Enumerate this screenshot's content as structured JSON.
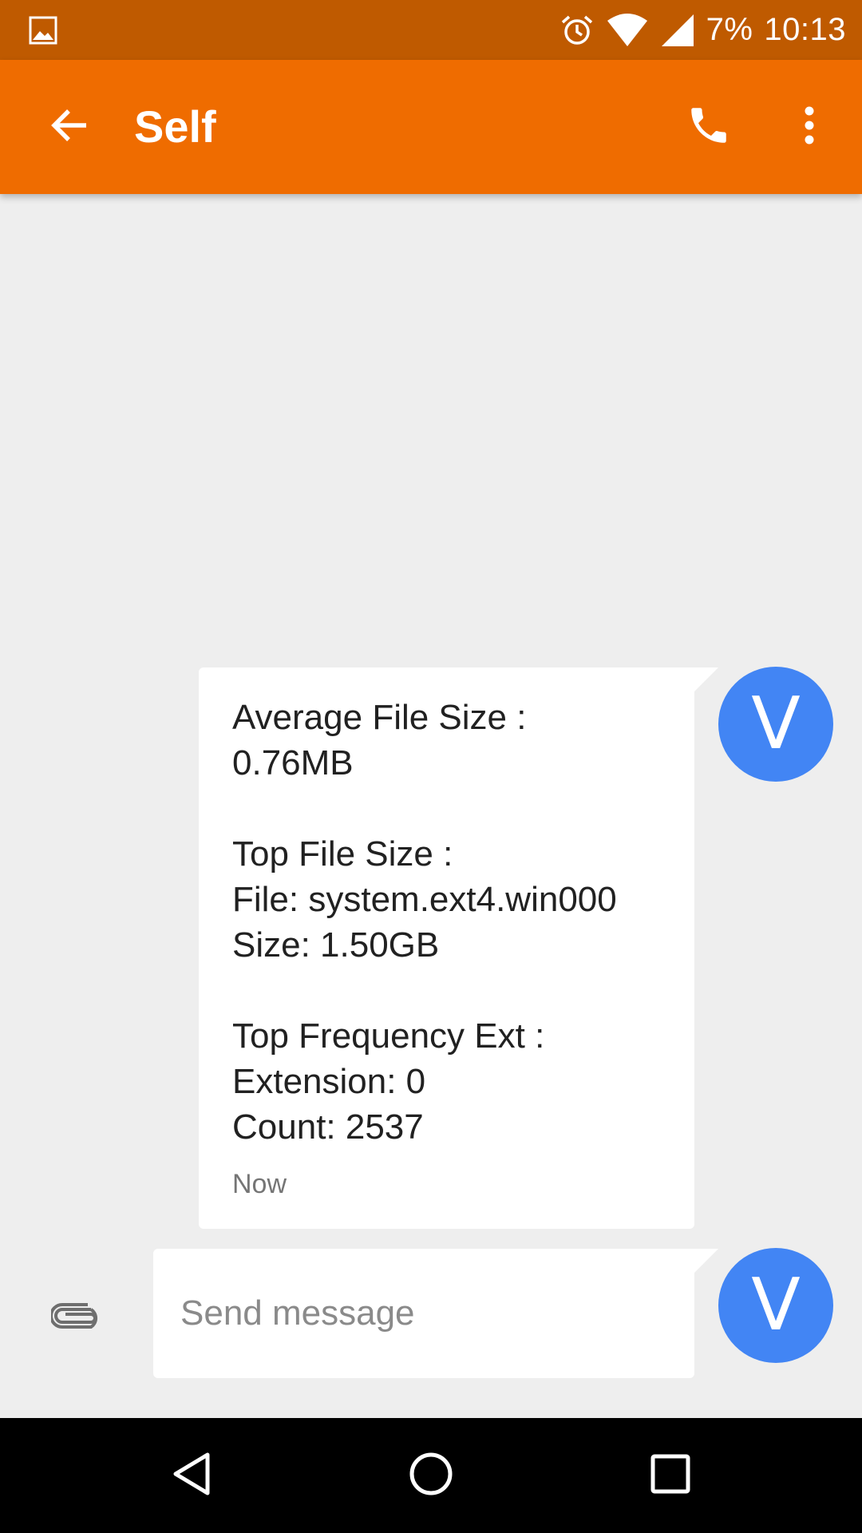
{
  "status_bar": {
    "battery": "7%",
    "time": "10:13",
    "icons": [
      "gallery-icon",
      "alarm-icon",
      "wifi-icon",
      "signal-icon"
    ],
    "background": "#bf5a00"
  },
  "app_bar": {
    "title": "Self",
    "background": "#ef6c00",
    "icons": [
      "back-arrow-icon",
      "phone-icon",
      "more-vert-icon"
    ]
  },
  "conversation": {
    "messages": [
      {
        "lines": [
          "Average File Size :",
          "0.76MB",
          "",
          "Top File Size :",
          "File: system.ext4.win000",
          "Size: 1.50GB",
          "",
          "Top Frequency Ext :",
          "Extension: 0",
          "Count: 2537"
        ],
        "timestamp": "Now",
        "avatar_letter": "V"
      }
    ]
  },
  "compose": {
    "placeholder": "Send message",
    "avatar_letter": "V",
    "attach_icon": "paperclip-icon"
  },
  "avatar_color": "#4285f4",
  "nav_bar": {
    "icons": [
      "nav-back-icon",
      "nav-home-icon",
      "nav-recents-icon"
    ]
  }
}
